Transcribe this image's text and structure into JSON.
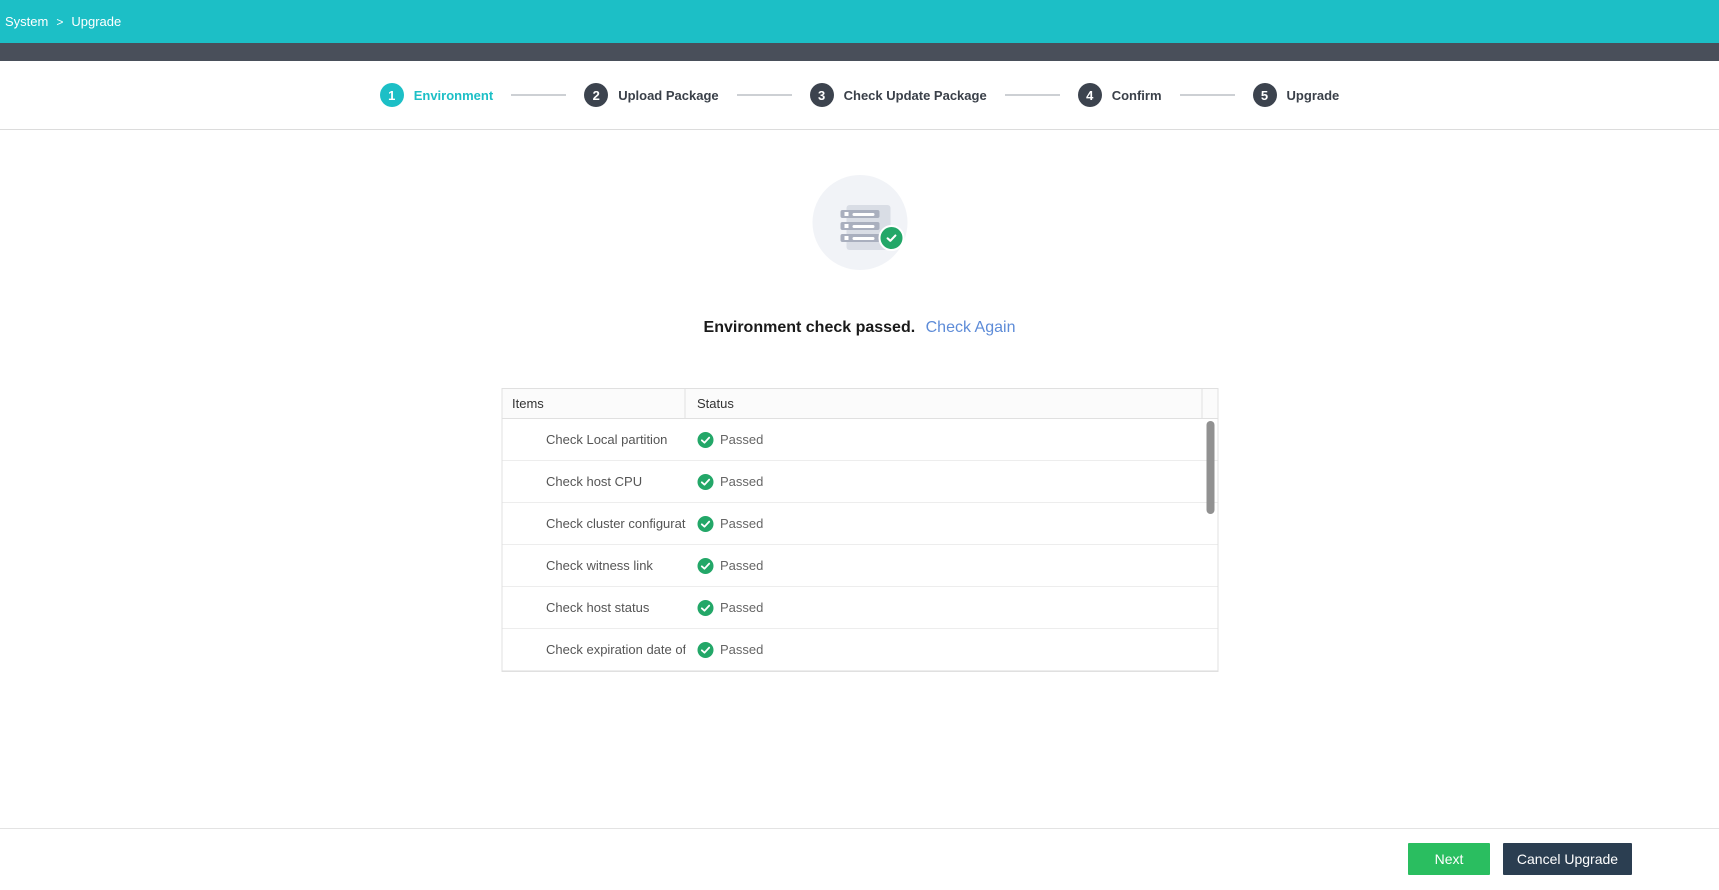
{
  "breadcrumb": {
    "items": [
      "System",
      "Upgrade"
    ],
    "separator": ">"
  },
  "stepper": {
    "steps": [
      {
        "number": "1",
        "label": "Environment",
        "state": "active"
      },
      {
        "number": "2",
        "label": "Upload Package",
        "state": "pending"
      },
      {
        "number": "3",
        "label": "Check Update Package",
        "state": "pending"
      },
      {
        "number": "4",
        "label": "Confirm",
        "state": "pending"
      },
      {
        "number": "5",
        "label": "Upgrade",
        "state": "pending"
      }
    ]
  },
  "result": {
    "icon": "server-check-icon",
    "headline": "Environment check passed.",
    "link_label": "Check Again"
  },
  "table": {
    "columns": [
      "Items",
      "Status"
    ],
    "rows": [
      {
        "item": "Check Local partition",
        "status": "Passed"
      },
      {
        "item": "Check host CPU",
        "status": "Passed"
      },
      {
        "item": "Check cluster configurat...",
        "status": "Passed"
      },
      {
        "item": "Check witness link",
        "status": "Passed"
      },
      {
        "item": "Check host status",
        "status": "Passed"
      },
      {
        "item": "Check expiration date of...",
        "status": "Passed"
      }
    ]
  },
  "footer": {
    "next_label": "Next",
    "cancel_label": "Cancel Upgrade"
  },
  "colors": {
    "accent_teal": "#1CBFC6",
    "subbar_dark": "#494F5A",
    "step_inactive": "#3C434E",
    "success_green": "#23A768",
    "link_blue": "#5E8CD8",
    "next_button_green": "#2ABE60",
    "cancel_button_navy": "#2B3E51",
    "scrollbar_gray": "#919191"
  }
}
